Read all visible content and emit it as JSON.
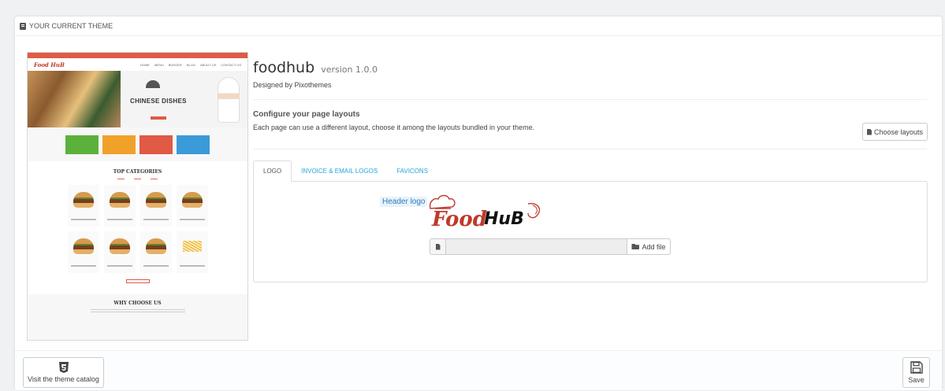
{
  "panel": {
    "heading": "YOUR CURRENT THEME",
    "heading_icon": "theme-icon"
  },
  "preview": {
    "logo": "Food HuB",
    "nav": [
      "HOME",
      "MENU",
      "BURGER",
      "BLOG",
      "ABOUT US",
      "CONTACT US"
    ],
    "hero_title": "CHINESE DISHES",
    "section_title": "TOP CATEGORIES",
    "section2_title": "WHY CHOOSE US",
    "box_colors": [
      "#5bb13b",
      "#f0a12a",
      "#e05a46",
      "#3b9ad8"
    ]
  },
  "theme": {
    "name": "foodhub",
    "version": "version 1.0.0",
    "designed_by": "Designed by Pixothemes"
  },
  "layouts": {
    "title": "Configure your page layouts",
    "description": "Each page can use a different layout, choose it among the layouts bundled in your theme.",
    "button_label": "Choose layouts"
  },
  "tabs": [
    {
      "label": "LOGO",
      "active": true
    },
    {
      "label": "INVOICE & EMAIL LOGOS",
      "active": false
    },
    {
      "label": "FAVICONS",
      "active": false
    }
  ],
  "logo_tab": {
    "header_logo_label": "Header logo",
    "logo_text_1": "Food",
    "logo_text_2": "HuB",
    "add_file_label": "Add file",
    "file_value": ""
  },
  "footer": {
    "catalog_label": "Visit the theme catalog",
    "save_label": "Save"
  },
  "colors": {
    "accent": "#25a5d9",
    "brand_red": "#c0392b",
    "label_blue": "#337ab7"
  }
}
